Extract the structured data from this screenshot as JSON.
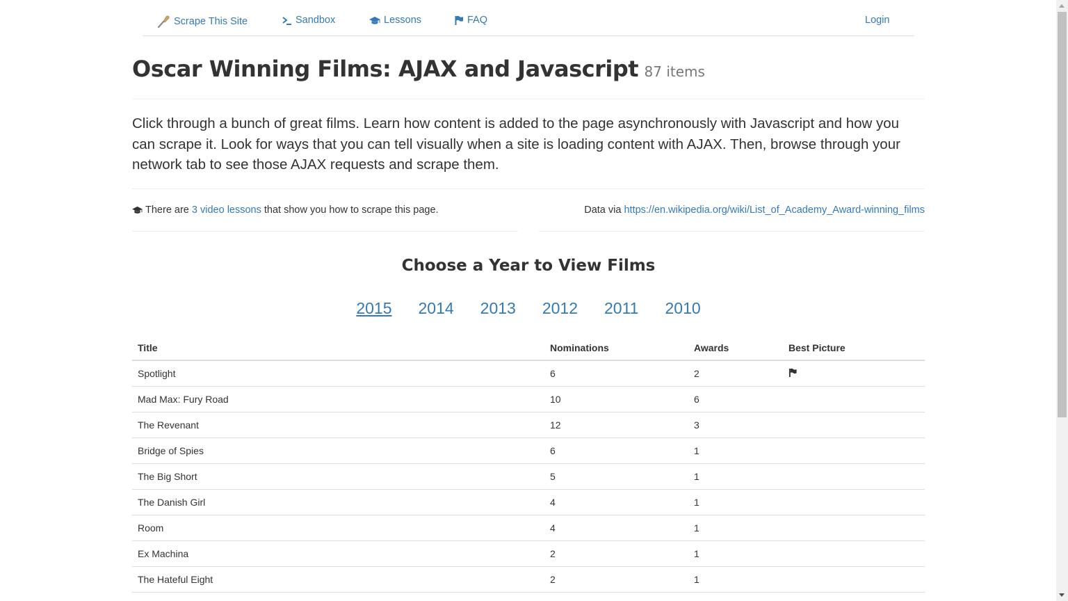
{
  "nav": {
    "brand": "Scrape This Site",
    "sandbox": "Sandbox",
    "lessons": "Lessons",
    "faq": "FAQ",
    "login": "Login"
  },
  "header": {
    "title": "Oscar Winning Films: AJAX and Javascript",
    "count": "87 items"
  },
  "description": "Click through a bunch of great films. Learn how content is added to the page asynchronously with Javascript and how you can scrape it. Look for ways that you can tell visually when a site is loading content with AJAX. Then, browse through your network tab to see those AJAX requests and scrape them.",
  "info": {
    "lessons_prefix": "There are",
    "lessons_link": "3 video lessons",
    "lessons_suffix": "that show you how to scrape this page.",
    "data_prefix": "Data via",
    "data_link": "https://en.wikipedia.org/wiki/List_of_Academy_Award-winning_films"
  },
  "year_section": {
    "heading": "Choose a Year to View Films",
    "years": [
      "2015",
      "2014",
      "2013",
      "2012",
      "2011",
      "2010"
    ],
    "selected": "2015"
  },
  "table": {
    "headers": [
      "Title",
      "Nominations",
      "Awards",
      "Best Picture"
    ],
    "rows": [
      {
        "title": "Spotlight",
        "nominations": "6",
        "awards": "2",
        "best_picture": true
      },
      {
        "title": "Mad Max: Fury Road",
        "nominations": "10",
        "awards": "6",
        "best_picture": false
      },
      {
        "title": "The Revenant",
        "nominations": "12",
        "awards": "3",
        "best_picture": false
      },
      {
        "title": "Bridge of Spies",
        "nominations": "6",
        "awards": "1",
        "best_picture": false
      },
      {
        "title": "The Big Short",
        "nominations": "5",
        "awards": "1",
        "best_picture": false
      },
      {
        "title": "The Danish Girl",
        "nominations": "4",
        "awards": "1",
        "best_picture": false
      },
      {
        "title": "Room",
        "nominations": "4",
        "awards": "1",
        "best_picture": false
      },
      {
        "title": "Ex Machina",
        "nominations": "2",
        "awards": "1",
        "best_picture": false
      },
      {
        "title": "The Hateful Eight",
        "nominations": "2",
        "awards": "1",
        "best_picture": false
      }
    ]
  },
  "colors": {
    "link": "#337ab7",
    "text": "#333333",
    "muted": "#777777",
    "border": "#dddddd"
  },
  "icons": {
    "brand": "spatula-icon",
    "sandbox": "terminal-icon",
    "lessons": "graduation-cap-icon",
    "faq": "flag-icon",
    "best_picture": "flag-icon"
  }
}
